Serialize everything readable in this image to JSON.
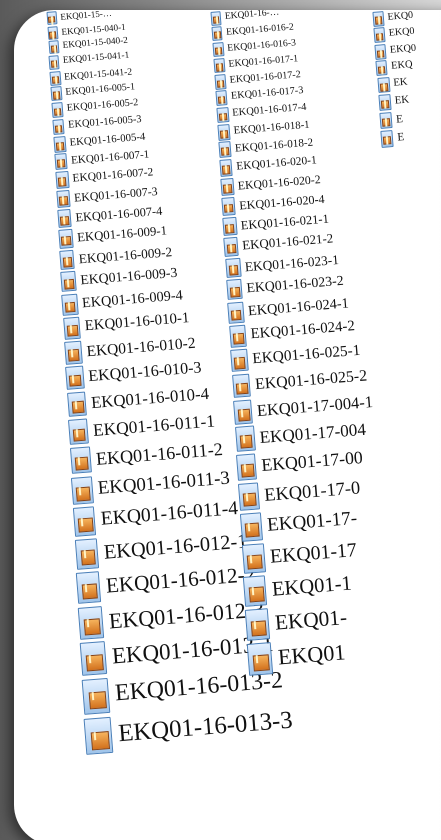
{
  "columns": [
    {
      "items": [
        "EKQ01-15-…",
        "EKQ01-15-040-1",
        "EKQ01-15-040-2",
        "EKQ01-15-041-1",
        "EKQ01-15-041-2",
        "EKQ01-16-005-1",
        "EKQ01-16-005-2",
        "EKQ01-16-005-3",
        "EKQ01-16-005-4",
        "EKQ01-16-007-1",
        "EKQ01-16-007-2",
        "EKQ01-16-007-3",
        "EKQ01-16-007-4",
        "EKQ01-16-009-1",
        "EKQ01-16-009-2",
        "EKQ01-16-009-3",
        "EKQ01-16-009-4",
        "EKQ01-16-010-1",
        "EKQ01-16-010-2",
        "EKQ01-16-010-3",
        "EKQ01-16-010-4",
        "EKQ01-16-011-1",
        "EKQ01-16-011-2",
        "EKQ01-16-011-3",
        "EKQ01-16-011-4",
        "EKQ01-16-012-1",
        "EKQ01-16-012-2",
        "EKQ01-16-012-3",
        "EKQ01-16-013-1",
        "EKQ01-16-013-2",
        "EKQ01-16-013-3"
      ]
    },
    {
      "items": [
        "EKQ01-16-…",
        "EKQ01-16-016-2",
        "EKQ01-16-016-3",
        "EKQ01-16-017-1",
        "EKQ01-16-017-2",
        "EKQ01-16-017-3",
        "EKQ01-16-017-4",
        "EKQ01-16-018-1",
        "EKQ01-16-018-2",
        "EKQ01-16-020-1",
        "EKQ01-16-020-2",
        "EKQ01-16-020-4",
        "EKQ01-16-021-1",
        "EKQ01-16-021-2",
        "EKQ01-16-023-1",
        "EKQ01-16-023-2",
        "EKQ01-16-024-1",
        "EKQ01-16-024-2",
        "EKQ01-16-025-1",
        "EKQ01-16-025-2",
        "EKQ01-17-004-1",
        "EKQ01-17-004",
        "EKQ01-17-00",
        "EKQ01-17-0",
        "EKQ01-17-",
        "EKQ01-17",
        "EKQ01-1",
        "EKQ01-",
        "EKQ01"
      ]
    },
    {
      "items": [
        "EKQ0",
        "EKQ0",
        "EKQ0",
        "EKQ",
        "EK",
        "EK",
        "E",
        "E"
      ]
    }
  ]
}
